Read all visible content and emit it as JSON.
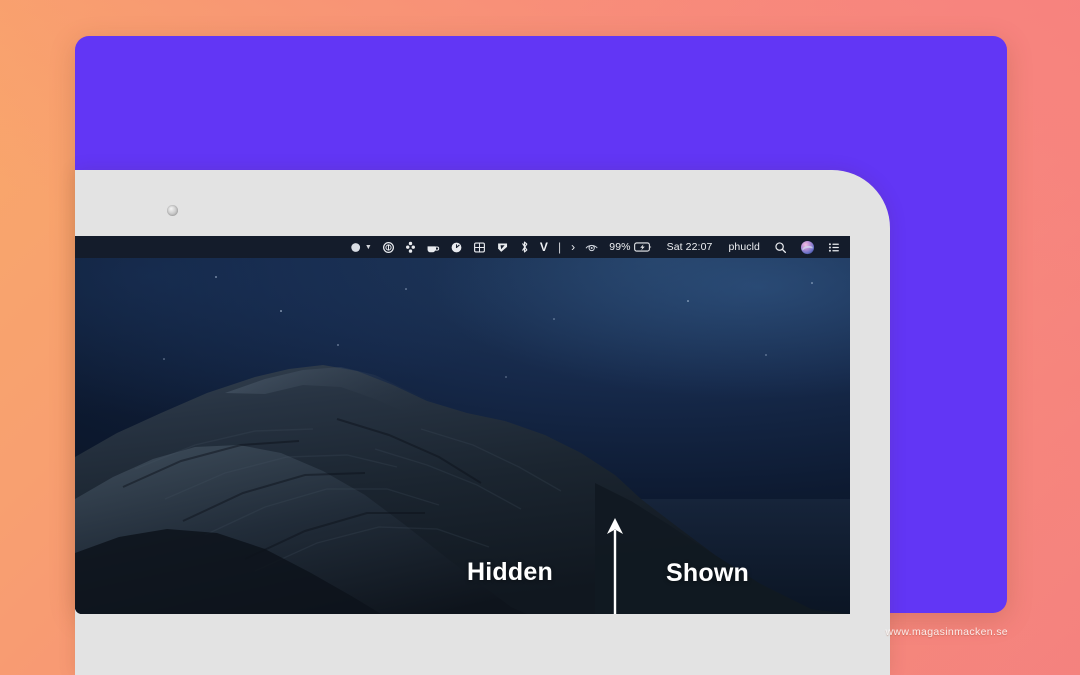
{
  "background": {
    "gradient_from": "#f9a86a",
    "gradient_to": "#f4827e"
  },
  "card": {
    "color": "#6236f5"
  },
  "device": {
    "bezel_color": "#e3e3e3",
    "camera": "camera-dot"
  },
  "menubar": {
    "background": "#141c2b",
    "left_icons": [
      {
        "name": "dropbox-sphere-icon",
        "glyph": "sphere",
        "has_caret": true
      },
      {
        "name": "circle-slash-icon",
        "glyph": "circle-bar",
        "has_caret": false
      },
      {
        "name": "dots-cluster-icon",
        "glyph": "dots",
        "has_caret": false
      },
      {
        "name": "mug-icon",
        "glyph": "mug",
        "has_caret": false
      },
      {
        "name": "clock-gauge-icon",
        "glyph": "gauge",
        "has_caret": false
      },
      {
        "name": "window-grid-icon",
        "glyph": "grid",
        "has_caret": false
      },
      {
        "name": "pennant-icon",
        "glyph": "pennant",
        "has_caret": false
      },
      {
        "name": "bluetooth-icon",
        "glyph": "bluetooth",
        "has_caret": false
      }
    ],
    "letter_items": [
      {
        "name": "vpn-v-icon",
        "label": "V"
      },
      {
        "name": "divider-bar-icon",
        "label": "|"
      },
      {
        "name": "chevron-right-icon",
        "label": "›"
      }
    ],
    "eye_icon": {
      "name": "bartender-eye-icon"
    },
    "battery": {
      "percent_label": "99%",
      "state": "charging"
    },
    "clock": "Sat 22:07",
    "user": "phucld",
    "right_icons": [
      {
        "name": "spotlight-search-icon"
      },
      {
        "name": "siri-icon"
      },
      {
        "name": "control-center-icon"
      }
    ]
  },
  "annotations": {
    "hidden_label": "Hidden",
    "shown_label": "Shown",
    "arrow": "up-arrow",
    "arrow_color": "#ffffff"
  },
  "watermark": "www.magasinmacken.se"
}
